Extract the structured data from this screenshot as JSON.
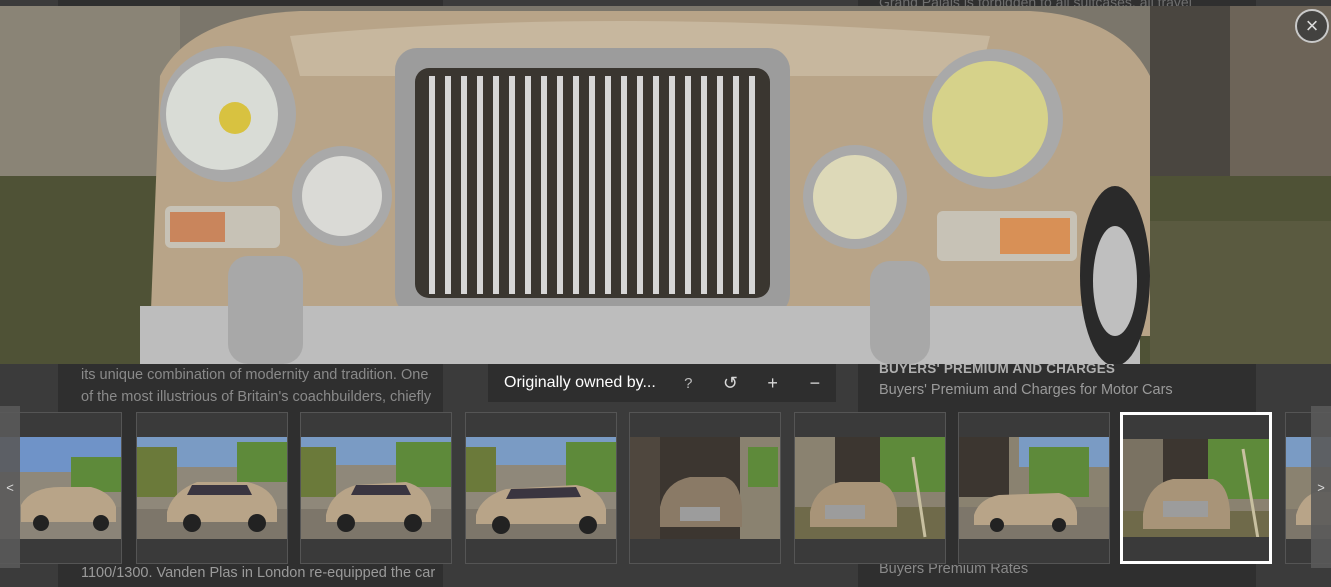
{
  "page": {
    "top_snippet": "Grand Palais is forbidden to all suitcases, all travel",
    "left_lines": [
      "its unique combination of modernity and tradition. One",
      "of the most illustrious of Britain's coachbuilders, chiefly"
    ],
    "left_bottom": "1100/1300. Vanden Plas in London re-equipped the car",
    "right_heading": "BUYERS' PREMIUM AND CHARGES",
    "right_sub": "Buyers' Premium and Charges for Motor Cars",
    "right_bottom": "Buyers Premium Rates"
  },
  "viewer": {
    "caption": "Originally owned by...",
    "tools": {
      "help": "?",
      "rotate": "↺",
      "zoom_in": "+",
      "zoom_out": "−"
    },
    "close": "×",
    "nav_prev": "<",
    "nav_next": ">",
    "selected_thumbnail": 8
  },
  "colors": {
    "car_body": "#b8a488",
    "chrome": "#c8c8c8",
    "overlay": "#2d2d2d"
  }
}
